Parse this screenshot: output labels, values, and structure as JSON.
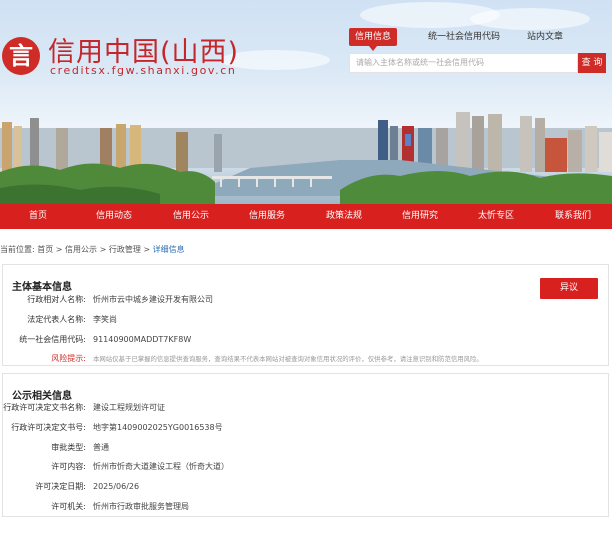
{
  "header": {
    "logo_char": "言",
    "logo_title": "信用中国(山西)",
    "logo_domain": "creditsx.fgw.shanxi.gov.cn"
  },
  "search": {
    "tabs": [
      "信用信息",
      "统一社会信用代码",
      "站内文章"
    ],
    "placeholder": "请输入主体名称或统一社会信用代码",
    "button": "查 询"
  },
  "nav": [
    "首页",
    "信用动态",
    "信用公示",
    "信用服务",
    "政策法规",
    "信用研究",
    "太忻专区",
    "联系我们"
  ],
  "breadcrumb": {
    "prefix": "当前位置:",
    "items": [
      "首页",
      "信用公示",
      "行政管理"
    ],
    "current": "详细信息",
    "separator": " > "
  },
  "basic": {
    "title": "主体基本信息",
    "objection_button": "异议",
    "rows": [
      {
        "label": "行政相对人名称:",
        "value": "忻州市云中城乡建设开发有限公司"
      },
      {
        "label": "法定代表人名称:",
        "value": "李笑尚"
      },
      {
        "label": "统一社会信用代码:",
        "value": "91140900MADDT7KF8W"
      },
      {
        "label": "风险提示:",
        "value": "本网站仅基于已掌握的信息提供查询服务，查询结果不代表本网站对被查询对象信用状况的评价，仅供参考，请注意识别和防范信用风险。"
      }
    ]
  },
  "public": {
    "title": "公示相关信息",
    "rows": [
      {
        "label": "行政许可决定文书名称:",
        "value": "建设工程规划许可证"
      },
      {
        "label": "行政许可决定文书号:",
        "value": "地字第1409002025YG0016538号"
      },
      {
        "label": "审批类型:",
        "value": "普通"
      },
      {
        "label": "许可内容:",
        "value": "忻州市忻奇大道建设工程（忻奇大道）"
      },
      {
        "label": "许可决定日期:",
        "value": "2025/06/26"
      },
      {
        "label": "许可机关:",
        "value": "忻州市行政审批服务管理局"
      }
    ]
  },
  "colors": {
    "brand_red": "#d8201f",
    "link_blue": "#2b6cb0"
  }
}
